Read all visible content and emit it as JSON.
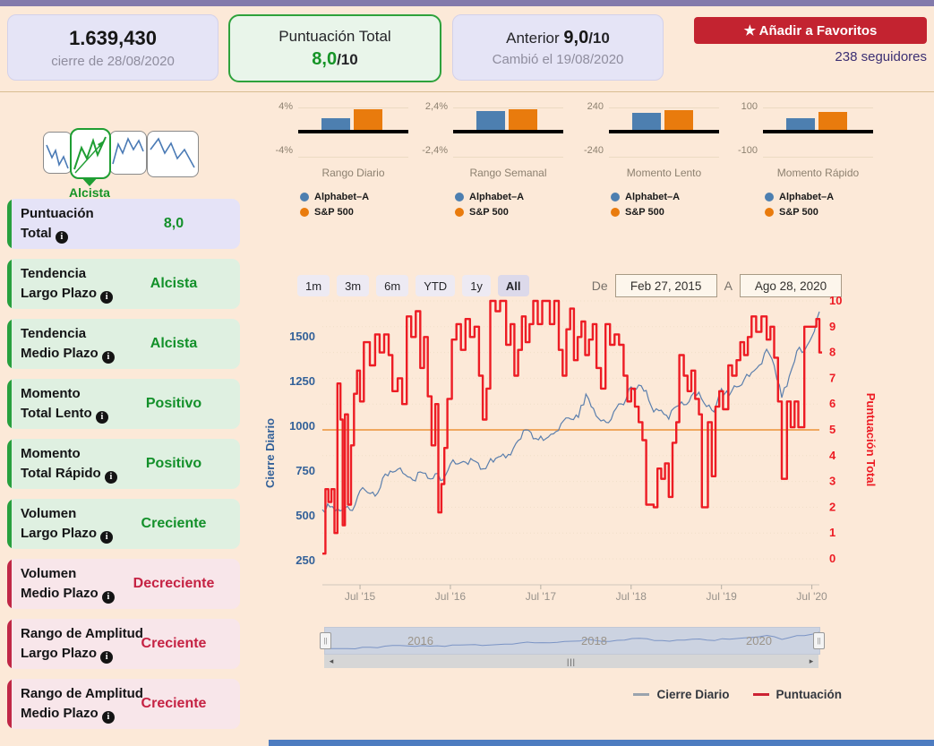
{
  "icons": {
    "star": "★",
    "info": "i",
    "arrow_left": "◂",
    "arrow_right": "▸",
    "grip": "|||",
    "handle": "||"
  },
  "header": {
    "price": {
      "value": "1.639,430",
      "subtitle": "cierre de 28/08/2020"
    },
    "score": {
      "title": "Puntuación Total",
      "value": "8,0",
      "denom": "/10"
    },
    "previous": {
      "label": "Anterior ",
      "value": "9,0",
      "denom": "/10",
      "subtitle": "Cambió el 19/08/2020"
    },
    "favorites_button": " Añadir a Favoritos",
    "followers": "238 seguidores"
  },
  "sidebar": {
    "pattern_label": "Alcista",
    "items": [
      {
        "l1": "Puntuación",
        "l2": "Total ",
        "value": "8,0",
        "tone": "purple"
      },
      {
        "l1": "Tendencia",
        "l2": "Largo Plazo ",
        "value": "Alcista",
        "tone": "green"
      },
      {
        "l1": "Tendencia",
        "l2": "Medio Plazo ",
        "value": "Alcista",
        "tone": "green"
      },
      {
        "l1": "Momento",
        "l2": "Total Lento ",
        "value": "Positivo",
        "tone": "green"
      },
      {
        "l1": "Momento",
        "l2": "Total Rápido ",
        "value": "Positivo",
        "tone": "green"
      },
      {
        "l1": "Volumen",
        "l2": "Largo Plazo ",
        "value": "Creciente",
        "tone": "green"
      },
      {
        "l1": "Volumen",
        "l2": "Medio Plazo ",
        "value": "Decreciente",
        "tone": "red"
      },
      {
        "l1": "Rango de Amplitud",
        "l2": "Largo Plazo ",
        "value": "Creciente",
        "tone": "red"
      },
      {
        "l1": "Rango de Amplitud",
        "l2": "Medio Plazo ",
        "value": "Creciente",
        "tone": "red"
      }
    ]
  },
  "range_selector": {
    "buttons": [
      "1m",
      "3m",
      "6m",
      "YTD",
      "1y",
      "All"
    ],
    "selected": "All",
    "from_label": "De",
    "from_value": "Feb 27, 2015",
    "to_label": "A",
    "to_value": "Ago 28, 2020"
  },
  "legend": {
    "items": [
      {
        "label": "Cierre Diario",
        "color": "#9aa3ad"
      },
      {
        "label": "Puntuación",
        "color": "#cc2233"
      }
    ]
  },
  "chart_data": [
    {
      "type": "bar",
      "title": "Rango Diario",
      "ymax": 4,
      "ymax_label": "4%",
      "ymin_label": "-4%",
      "series": [
        {
          "name": "Alphabet–A",
          "value": 2.1,
          "color": "#4d7fb0"
        },
        {
          "name": "S&P 500",
          "value": 3.6,
          "color": "#e97b0d"
        }
      ]
    },
    {
      "type": "bar",
      "title": "Rango Semanal",
      "ymax": 2.4,
      "ymax_label": "2,4%",
      "ymin_label": "-2,4%",
      "series": [
        {
          "name": "Alphabet–A",
          "value": 2.0,
          "color": "#4d7fb0"
        },
        {
          "name": "S&P 500",
          "value": 2.2,
          "color": "#e97b0d"
        }
      ]
    },
    {
      "type": "bar",
      "title": "Momento Lento",
      "ymax": 240,
      "ymax_label": "240",
      "ymin_label": "-240",
      "series": [
        {
          "name": "Alphabet–A",
          "value": 180,
          "color": "#4d7fb0"
        },
        {
          "name": "S&P 500",
          "value": 215,
          "color": "#e97b0d"
        }
      ]
    },
    {
      "type": "bar",
      "title": "Momento Rápido",
      "ymax": 100,
      "ymax_label": "100",
      "ymin_label": "-100",
      "series": [
        {
          "name": "Alphabet–A",
          "value": 50,
          "color": "#4d7fb0"
        },
        {
          "name": "S&P 500",
          "value": 80,
          "color": "#e97b0d"
        }
      ]
    },
    {
      "type": "line",
      "title": "Cierre Diario y Puntuación Feb 2015 - Ago 2020",
      "left_axis": {
        "label": "Cierre Diario",
        "color": "#336199",
        "ticks": [
          250,
          500,
          750,
          1000,
          1250,
          1500
        ]
      },
      "right_axis": {
        "label": "Puntuación Total",
        "color": "#ed1c24",
        "ticks": [
          0,
          1,
          2,
          3,
          4,
          5,
          6,
          7,
          8,
          9,
          10
        ]
      },
      "x_ticks": [
        {
          "m": 5,
          "label": "Jul '15"
        },
        {
          "m": 17,
          "label": "Jul '16"
        },
        {
          "m": 29,
          "label": "Jul '17"
        },
        {
          "m": 41,
          "label": "Jul '18"
        },
        {
          "m": 53,
          "label": "Jul '19"
        },
        {
          "m": 65,
          "label": "Jul '20"
        }
      ],
      "threshold": {
        "value": 5,
        "color": "#f0a860"
      },
      "series": [
        {
          "name": "Cierre Diario",
          "color": "#5b7fad",
          "monthly": [
            535,
            550,
            540,
            545,
            530,
            640,
            630,
            610,
            710,
            750,
            760,
            730,
            700,
            745,
            710,
            735,
            700,
            790,
            790,
            800,
            810,
            760,
            790,
            820,
            845,
            840,
            920,
            980,
            930,
            945,
            940,
            970,
            1030,
            1040,
            1050,
            1180,
            1100,
            1030,
            1020,
            1100,
            1120,
            1220,
            1230,
            1200,
            1080,
            1090,
            1040,
            1110,
            1120,
            1170,
            1190,
            1110,
            1080,
            1210,
            1170,
            1220,
            1260,
            1300,
            1340,
            1430,
            1340,
            1160,
            1280,
            1420,
            1420,
            1500,
            1640
          ]
        },
        {
          "name": "Puntuación",
          "color": "#ed1c24",
          "steps": [
            [
              0,
              0.2
            ],
            [
              0.4,
              2.7
            ],
            [
              0.8,
              2.2
            ],
            [
              1.2,
              2.7
            ],
            [
              1.6,
              1.0
            ],
            [
              2.0,
              6.8
            ],
            [
              2.4,
              5.4
            ],
            [
              2.7,
              1.3
            ],
            [
              3.0,
              5.6
            ],
            [
              3.4,
              2.1
            ],
            [
              3.8,
              4.4
            ],
            [
              4.2,
              6.4
            ],
            [
              4.6,
              7.3
            ],
            [
              5.0,
              6.1
            ],
            [
              5.5,
              8.4
            ],
            [
              6.3,
              7.5
            ],
            [
              7.0,
              8.7
            ],
            [
              7.6,
              8.0
            ],
            [
              8.2,
              8.7
            ],
            [
              8.8,
              7.9
            ],
            [
              9.3,
              6.5
            ],
            [
              10.0,
              7.0
            ],
            [
              10.6,
              6.0
            ],
            [
              11.2,
              9.4
            ],
            [
              11.8,
              8.6
            ],
            [
              12.4,
              9.6
            ],
            [
              13.0,
              7.4
            ],
            [
              13.5,
              8.6
            ],
            [
              14.0,
              6.3
            ],
            [
              14.5,
              4.4
            ],
            [
              15.0,
              6.0
            ],
            [
              15.4,
              1.8
            ],
            [
              15.8,
              2.9
            ],
            [
              16.2,
              4.3
            ],
            [
              16.6,
              6.2
            ],
            [
              17.2,
              8.5
            ],
            [
              17.8,
              9.1
            ],
            [
              18.4,
              8.1
            ],
            [
              19.0,
              9.3
            ],
            [
              19.6,
              8.6
            ],
            [
              20.2,
              9.0
            ],
            [
              20.8,
              7.1
            ],
            [
              21.3,
              5.4
            ],
            [
              21.8,
              6.6
            ],
            [
              22.3,
              10.0
            ],
            [
              23.0,
              9.6
            ],
            [
              23.6,
              10.0
            ],
            [
              24.4,
              8.3
            ],
            [
              25.0,
              9.1
            ],
            [
              25.5,
              7.1
            ],
            [
              26.0,
              8.1
            ],
            [
              26.5,
              9.4
            ],
            [
              27.0,
              8.4
            ],
            [
              27.5,
              9.1
            ],
            [
              28.0,
              10.0
            ],
            [
              28.6,
              9.1
            ],
            [
              29.2,
              10.0
            ],
            [
              30.2,
              9.1
            ],
            [
              30.8,
              10.0
            ],
            [
              31.4,
              8.1
            ],
            [
              31.9,
              7.1
            ],
            [
              32.4,
              8.9
            ],
            [
              32.9,
              9.7
            ],
            [
              33.4,
              7.7
            ],
            [
              33.9,
              8.6
            ],
            [
              34.4,
              9.2
            ],
            [
              34.9,
              7.9
            ],
            [
              35.4,
              8.5
            ],
            [
              35.9,
              9.1
            ],
            [
              36.4,
              7.4
            ],
            [
              37.0,
              6.6
            ],
            [
              37.6,
              9.1
            ],
            [
              38.2,
              8.3
            ],
            [
              38.8,
              8.7
            ],
            [
              39.4,
              8.3
            ],
            [
              40.0,
              7.1
            ],
            [
              40.5,
              6.1
            ],
            [
              41.0,
              6.6
            ],
            [
              41.5,
              5.9
            ],
            [
              42.0,
              5.3
            ],
            [
              42.5,
              4.6
            ],
            [
              43.0,
              2.1
            ],
            [
              44.0,
              2.0
            ],
            [
              44.5,
              3.5
            ],
            [
              45.0,
              3.1
            ],
            [
              45.5,
              3.7
            ],
            [
              46.0,
              2.4
            ],
            [
              46.5,
              4.5
            ],
            [
              47.0,
              5.3
            ],
            [
              47.4,
              7.9
            ],
            [
              48.0,
              7.1
            ],
            [
              48.5,
              6.5
            ],
            [
              49.0,
              7.3
            ],
            [
              49.5,
              6.2
            ],
            [
              50.0,
              5.6
            ],
            [
              50.4,
              2.0
            ],
            [
              51.2,
              5.3
            ],
            [
              51.7,
              3.2
            ],
            [
              52.2,
              5.9
            ],
            [
              52.7,
              6.5
            ],
            [
              53.2,
              5.8
            ],
            [
              53.9,
              7.5
            ],
            [
              54.4,
              7.1
            ],
            [
              55.0,
              7.7
            ],
            [
              55.5,
              8.4
            ],
            [
              56.0,
              7.9
            ],
            [
              56.5,
              8.6
            ],
            [
              57.0,
              9.4
            ],
            [
              57.6,
              8.8
            ],
            [
              58.3,
              9.4
            ],
            [
              59.0,
              8.5
            ],
            [
              59.5,
              9.0
            ],
            [
              60.0,
              7.8
            ],
            [
              60.5,
              6.1
            ],
            [
              61.0,
              3.1
            ],
            [
              61.7,
              6.1
            ],
            [
              62.2,
              5.1
            ],
            [
              62.7,
              6.1
            ],
            [
              63.2,
              5.1
            ],
            [
              64.0,
              9.0
            ],
            [
              65.6,
              9.3
            ],
            [
              66.0,
              8.0
            ]
          ]
        }
      ]
    },
    {
      "type": "area",
      "title": "navigator",
      "color": "#7b94c5",
      "labels": [
        {
          "x": 92,
          "label": "2016"
        },
        {
          "x": 286,
          "label": "2018"
        },
        {
          "x": 470,
          "label": "2020"
        }
      ]
    }
  ]
}
